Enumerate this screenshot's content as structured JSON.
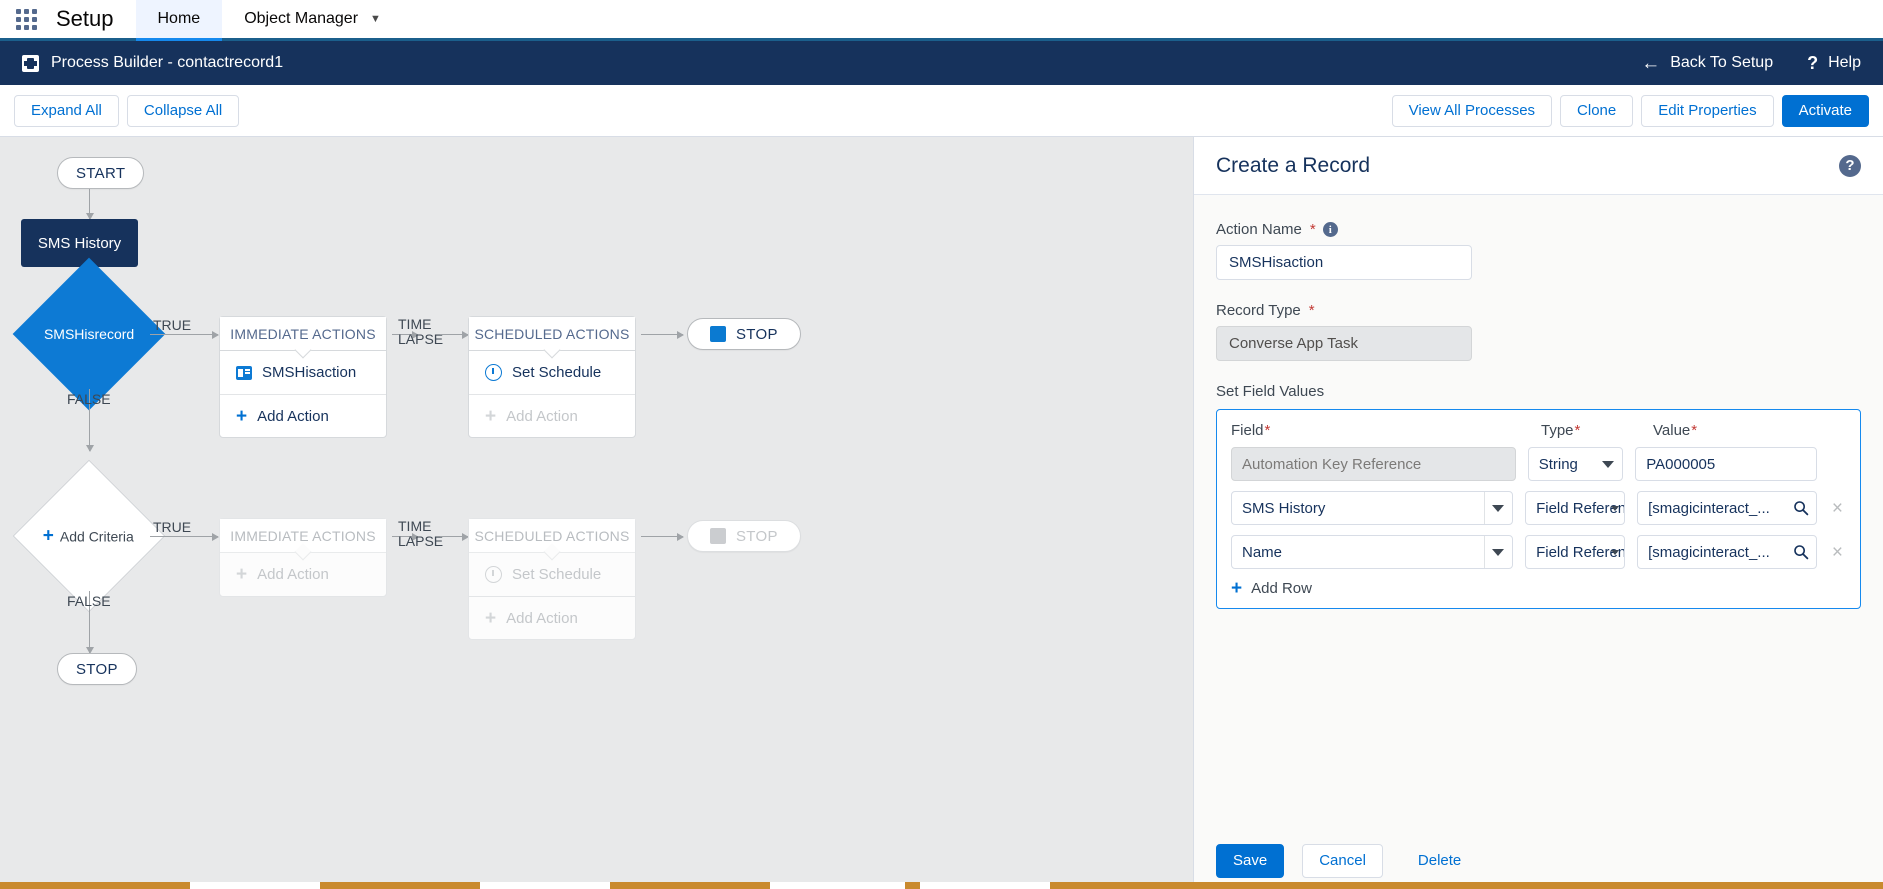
{
  "global_nav": {
    "app_launcher": "app-launcher-icon",
    "setup_title": "Setup",
    "tabs": [
      {
        "label": "Home",
        "active": true
      },
      {
        "label": "Object Manager",
        "active": false,
        "chevron": "⌄"
      }
    ]
  },
  "process_header": {
    "title": "Process Builder - contactrecord1",
    "back_label": "Back To Setup",
    "back_arrow": "←",
    "help_label": "Help",
    "help_glyph": "?"
  },
  "toolbar": {
    "left": [
      {
        "label": "Expand All"
      },
      {
        "label": "Collapse All"
      }
    ],
    "right": [
      {
        "label": "View All Processes",
        "style": "neutral"
      },
      {
        "label": "Clone",
        "style": "neutral"
      },
      {
        "label": "Edit Properties",
        "style": "neutral"
      },
      {
        "label": "Activate",
        "style": "brand"
      }
    ]
  },
  "canvas": {
    "start_label": "START",
    "object_node": "SMS History",
    "criteria": [
      {
        "label": "SMSHisrecord",
        "true_label": "TRUE",
        "false_label": "FALSE",
        "immediate_header": "IMMEDIATE ACTIONS",
        "immediate_items": [
          {
            "label": "SMSHisaction",
            "icon": "record-create-icon",
            "dim": false
          },
          {
            "label": "Add Action",
            "icon": "plus-icon",
            "dim": false
          }
        ],
        "time_lapse_line1": "TIME",
        "time_lapse_line2": "LAPSE",
        "scheduled_header": "SCHEDULED ACTIONS",
        "scheduled_items": [
          {
            "label": "Set Schedule",
            "icon": "clock-icon",
            "dim": false
          },
          {
            "label": "Add Action",
            "icon": "plus-icon",
            "dim": true
          }
        ],
        "stop_label": "STOP",
        "stop_dim": false
      },
      {
        "label": "Add Criteria",
        "true_label": "TRUE",
        "false_label": "FALSE",
        "immediate_header": "IMMEDIATE ACTIONS",
        "immediate_items": [
          {
            "label": "Add Action",
            "icon": "plus-icon",
            "dim": true
          }
        ],
        "time_lapse_line1": "TIME",
        "time_lapse_line2": "LAPSE",
        "scheduled_header": "SCHEDULED ACTIONS",
        "scheduled_items": [
          {
            "label": "Set Schedule",
            "icon": "clock-icon",
            "dim": true
          },
          {
            "label": "Add Action",
            "icon": "plus-icon",
            "dim": true
          }
        ],
        "stop_label": "STOP",
        "stop_dim": true
      }
    ],
    "end_stop_label": "STOP"
  },
  "panel": {
    "title": "Create a Record",
    "help_glyph": "?",
    "action_name": {
      "label": "Action Name",
      "required": "*",
      "info": "i",
      "value": "SMSHisaction"
    },
    "record_type": {
      "label": "Record Type",
      "required": "*",
      "value": "Converse App Task"
    },
    "set_field_values": {
      "label": "Set Field Values",
      "columns": [
        {
          "label": "Field",
          "required": "*"
        },
        {
          "label": "Type",
          "required": "*"
        },
        {
          "label": "Value",
          "required": "*"
        }
      ],
      "rows": [
        {
          "field": "Automation Key Reference",
          "field_readonly": true,
          "field_has_dropdown": false,
          "type": "String",
          "value": "PA000005",
          "value_has_search": false,
          "removable": false
        },
        {
          "field": "SMS History",
          "field_readonly": false,
          "field_has_dropdown": true,
          "type": "Field Reference",
          "value": "[smagicinteract_...",
          "value_has_search": true,
          "removable": true
        },
        {
          "field": "Name",
          "field_readonly": false,
          "field_has_dropdown": true,
          "type": "Field Reference",
          "value": "[smagicinteract_...",
          "value_has_search": true,
          "removable": true
        }
      ],
      "add_row_label": "Add Row",
      "remove_glyph": "×"
    },
    "footer": [
      {
        "label": "Save",
        "style": "brand"
      },
      {
        "label": "Cancel",
        "style": "neutral"
      },
      {
        "label": "Delete",
        "style": "flat"
      }
    ]
  },
  "colors": {
    "brand_blue": "#0070d2",
    "dark_navy": "#16325c",
    "criteria_blue": "#0d7ad4",
    "canvas_bg": "#e8e9ea",
    "required_red": "#c23934",
    "focus_blue": "#1589ee"
  }
}
